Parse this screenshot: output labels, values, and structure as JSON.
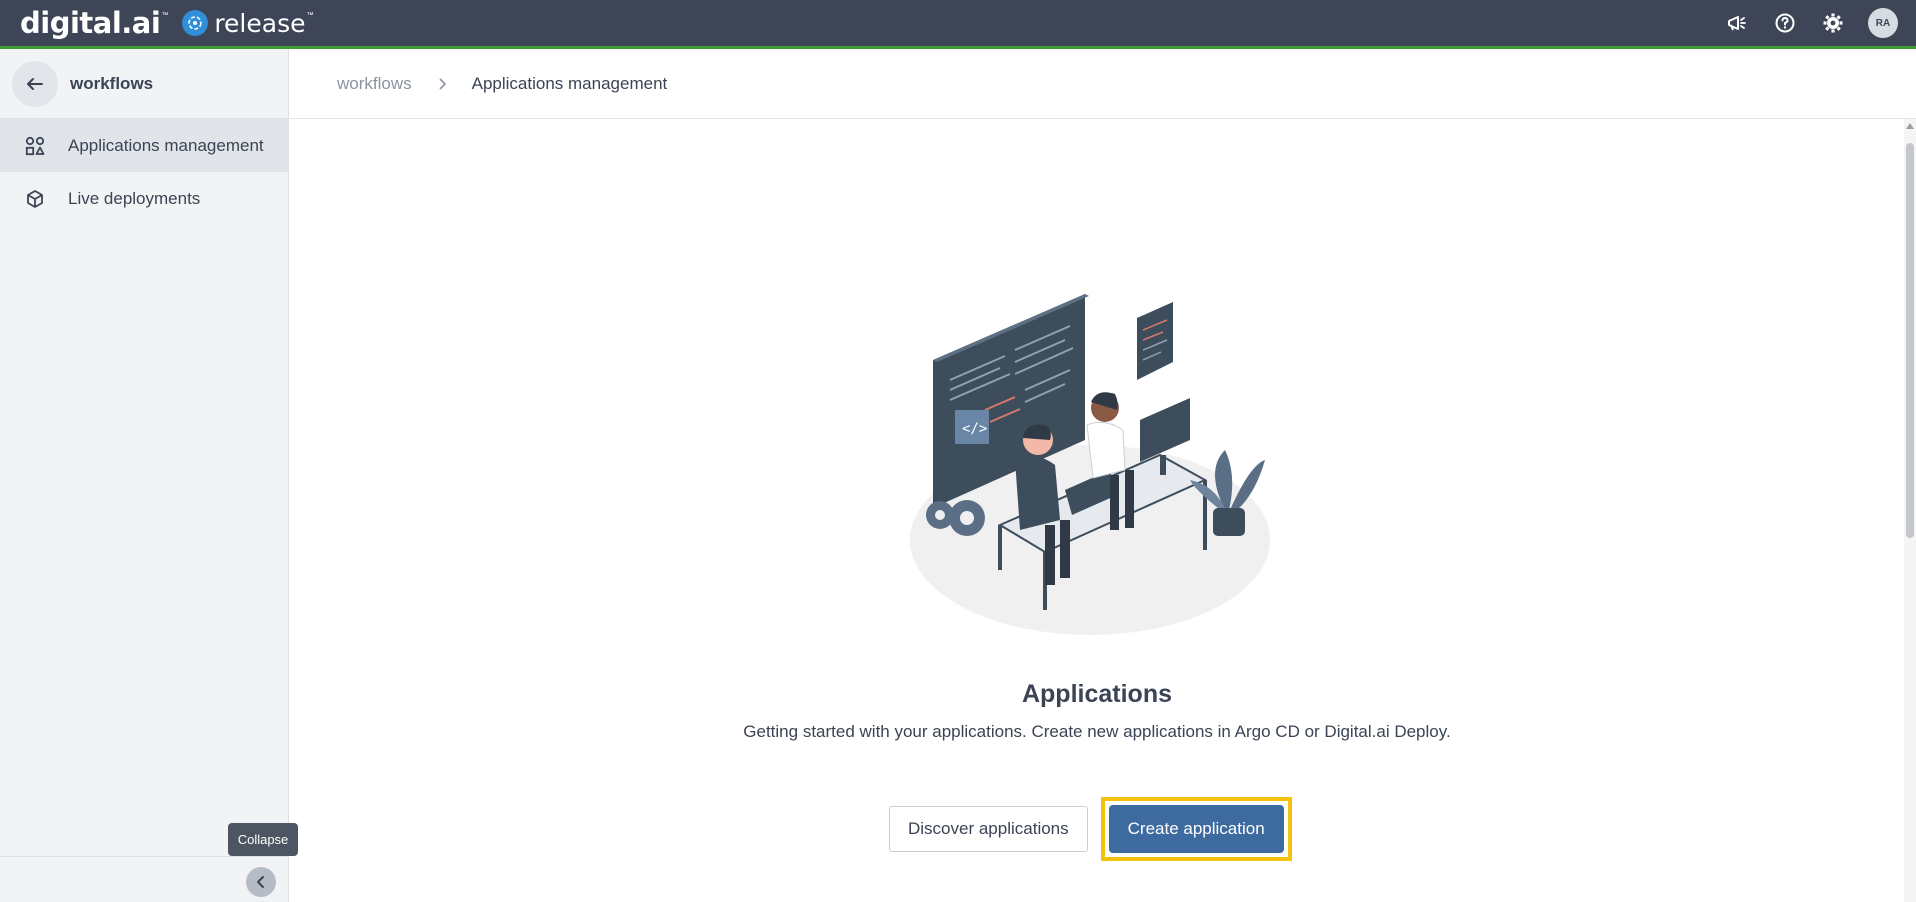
{
  "header": {
    "brand": "digital.ai",
    "brand_tm": "™",
    "product": "release",
    "product_tm": "™",
    "avatar_initials": "RA",
    "icons": [
      "megaphone-icon",
      "help-icon",
      "gear-icon"
    ]
  },
  "sidebar": {
    "title": "workflows",
    "items": [
      {
        "label": "Applications management",
        "icon": "apps-grid-icon",
        "active": true
      },
      {
        "label": "Live deployments",
        "icon": "cube-icon",
        "active": false
      }
    ],
    "collapse_tooltip": "Collapse"
  },
  "breadcrumb": {
    "items": [
      "workflows",
      "Applications management"
    ]
  },
  "empty_state": {
    "title": "Applications",
    "description": "Getting started with your applications. Create new applications in Argo CD or Digital.ai Deploy.",
    "secondary_button": "Discover applications",
    "primary_button": "Create application"
  },
  "colors": {
    "topbar": "#3d4556",
    "accent_line": "#3f9a2f",
    "primary": "#3d6a9f",
    "highlight": "#f4c20d"
  }
}
